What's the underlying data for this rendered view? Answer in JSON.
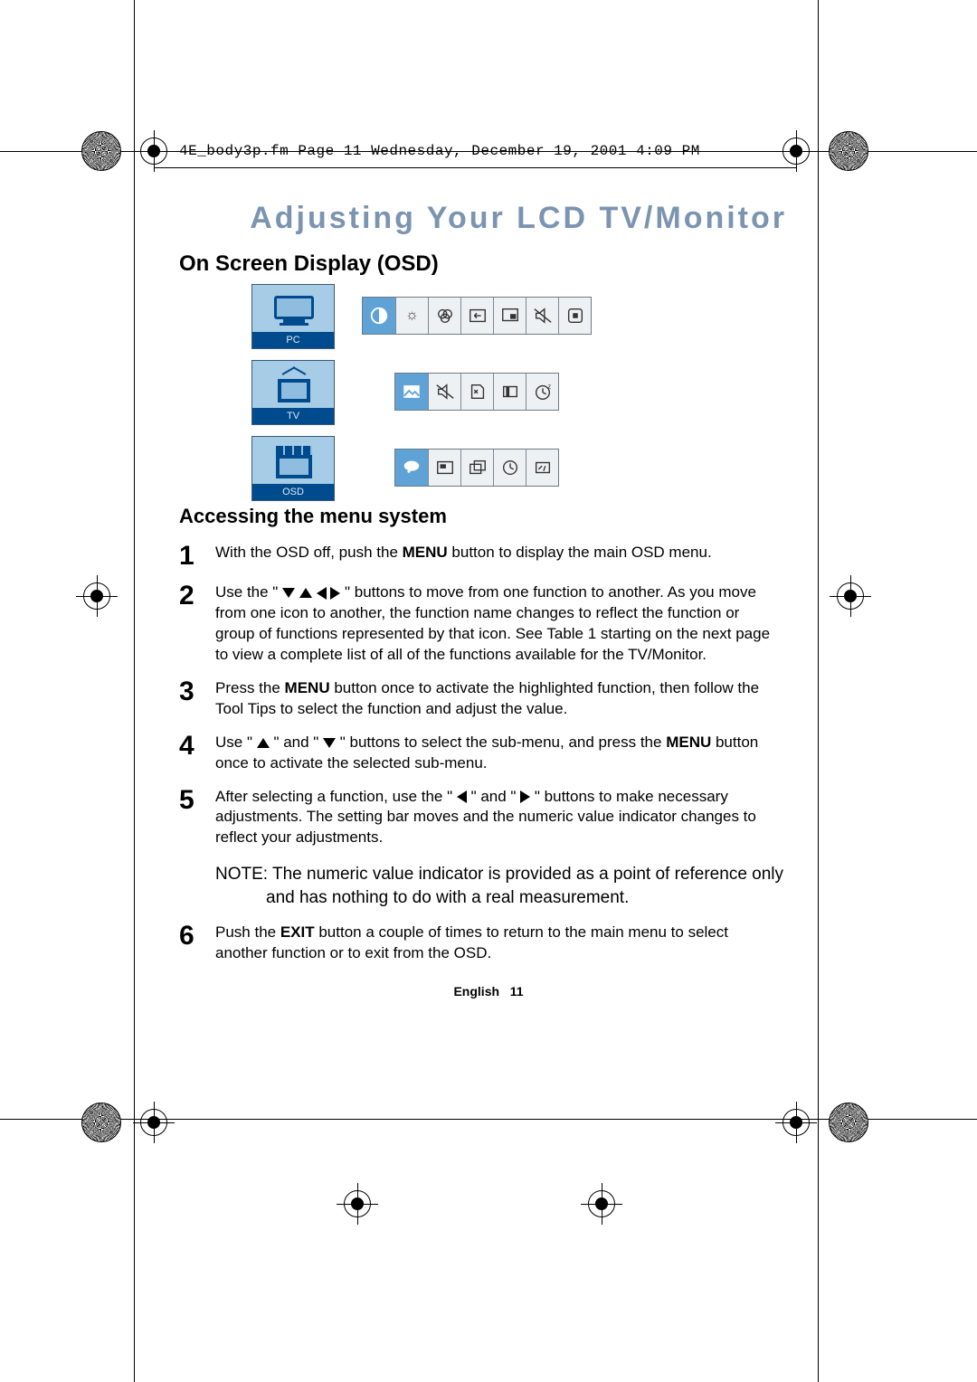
{
  "header_line": "4E_body3p.fm  Page 11  Wednesday, December 19, 2001  4:09 PM",
  "title": "Adjusting Your LCD TV/Monitor",
  "section_osd": "On Screen Display (OSD)",
  "osd_rows": {
    "pc": {
      "label": "PC"
    },
    "tv": {
      "label": "TV"
    },
    "osd": {
      "label": "OSD"
    }
  },
  "section_access": "Accessing the menu system",
  "steps": [
    {
      "num": "1",
      "parts": [
        "With the OSD off, push the ",
        "MENU",
        " button to display the main OSD menu."
      ]
    },
    {
      "num": "2",
      "parts": [
        "Use the \" ",
        "▼ ▲ ◀ ▶",
        " \" buttons to move from one function to another. As you move from one icon to another, the function name changes to reflect the function or group of functions represented by that icon. See Table 1 starting on the next page to view a complete list of all of the functions available for the TV/Monitor."
      ]
    },
    {
      "num": "3",
      "parts": [
        "Press the ",
        "MENU",
        " button once to activate the highlighted function, then follow the Tool Tips to select the function and adjust the value."
      ]
    },
    {
      "num": "4",
      "parts": [
        "Use \" ",
        "▲",
        " \" and \" ",
        "▼",
        " \" buttons to select the sub-menu,  and press the ",
        "MENU",
        " button once to activate the selected sub-menu."
      ]
    },
    {
      "num": "5",
      "parts": [
        "After selecting a function, use the \" ",
        "◀",
        "  \" and \" ",
        "▶",
        "  \" buttons to make necessary adjustments. The setting bar moves and the numeric value indicator changes to reflect your adjustments."
      ]
    }
  ],
  "note": "NOTE: The numeric value indicator is provided as a point of reference only and has nothing to do with a real measurement.",
  "step6": {
    "num": "6",
    "parts": [
      "Push the ",
      "EXIT",
      " button a couple of times to return to the main menu to select another function or to exit from the OSD."
    ]
  },
  "footer_lang": "English",
  "footer_page": "11"
}
